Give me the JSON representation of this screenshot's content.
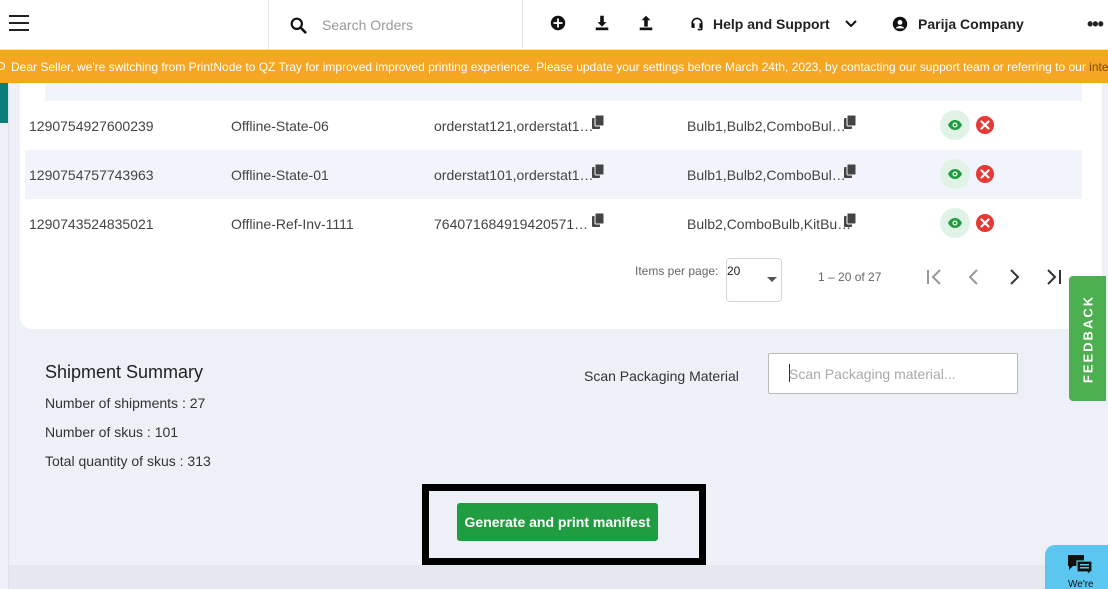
{
  "topbar": {
    "search_placeholder": "Search Orders",
    "help_label": "Help and Support",
    "company_name": "Parija Company",
    "more_label": "•••"
  },
  "banner": {
    "text": "Dear Seller, we're switching from PrintNode to QZ Tray for improved improved printing experience. Please update your settings before March 24th, 2023, by contacting our support team or referring to our ",
    "link_text": "integ"
  },
  "orders": {
    "rows": [
      {
        "order_id": "1290754927600239",
        "channel": "Offline-State-06",
        "order_ref": "orderstat121,orderstat1…",
        "skus": "Bulb1,Bulb2,ComboBul…"
      },
      {
        "order_id": "1290754757743963",
        "channel": "Offline-State-01",
        "order_ref": "orderstat101,orderstat1…",
        "skus": "Bulb1,Bulb2,ComboBul…"
      },
      {
        "order_id": "1290743524835021",
        "channel": "Offline-Ref-Inv-1111",
        "order_ref": "764071684919420571…",
        "skus": "Bulb2,ComboBulb,KitBu…"
      }
    ]
  },
  "pagination": {
    "items_per_page_label": "Items per page:",
    "items_per_page_value": "20",
    "range_text": "1 – 20 of 27"
  },
  "summary": {
    "title": "Shipment Summary",
    "shipments_line": "Number of shipments :  27",
    "skus_line": "Number of skus :  101",
    "qty_line": "Total quantity of skus : 313"
  },
  "scan": {
    "label": "Scan Packaging Material",
    "placeholder": "Scan Packaging material..."
  },
  "actions": {
    "generate_label": "Generate and print manifest"
  },
  "widgets": {
    "feedback_label": "FEEDBACK",
    "chat_label": "We're"
  },
  "colors": {
    "banner": "#f5a623",
    "primary_button": "#1f9d40",
    "feedback": "#4caf50",
    "chat": "#5bc7f0",
    "delete_icon": "#e53935",
    "view_icon": "#1f9d40"
  }
}
